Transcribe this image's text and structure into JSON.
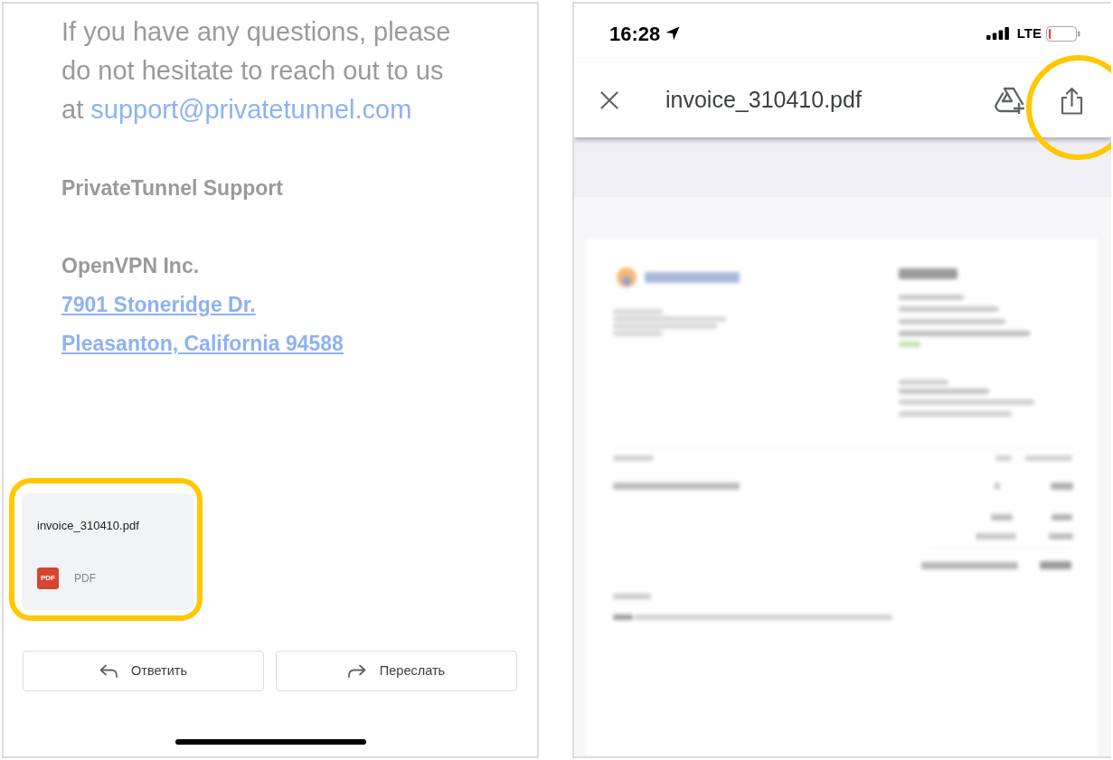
{
  "email": {
    "paragraph": "If you have any questions, please do not hesitate to reach out to us at",
    "email_link": "support@privatetunnel.com",
    "signature": "PrivateTunnel Support",
    "company": "OpenVPN Inc.",
    "address_lines": [
      "7901 Stoneridge Dr.",
      "Pleasanton, California 94588"
    ]
  },
  "attachment": {
    "file_name": "invoice_310410.pdf",
    "icon_text": "PDF",
    "file_type": "PDF",
    "highlighted": true
  },
  "actions": [
    {
      "kind": "reply",
      "label": "Ответить"
    },
    {
      "kind": "forward",
      "label": "Переслать"
    }
  ],
  "viewer": {
    "status_bar": {
      "time": "16:28",
      "network": "LTE"
    },
    "header": {
      "title": "invoice_310410.pdf",
      "actions": [
        {
          "kind": "drive",
          "highlighted": false
        },
        {
          "kind": "share",
          "highlighted": true
        }
      ]
    },
    "document_preview": {
      "blurred": true
    }
  }
}
